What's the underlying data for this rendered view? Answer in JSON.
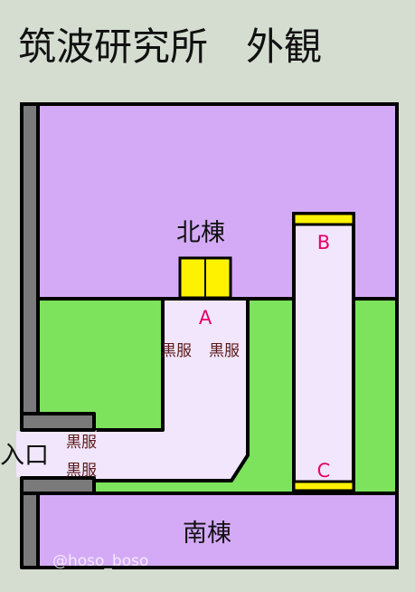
{
  "title": "筑波研究所　外観",
  "labels": {
    "north_building": "北棟",
    "south_building": "南棟",
    "entrance": "入口",
    "point_a": "A",
    "point_b": "B",
    "point_c": "C",
    "guard_1": "黒服",
    "guard_2": "黒服",
    "guard_3": "黒服",
    "guard_4": "黒服"
  },
  "watermark": "@hoso_boso",
  "colors": {
    "background": "#d5ddd1",
    "building": "#d4aaf7",
    "lawn": "#7de35c",
    "corridor": "#f1e6fb",
    "door": "#fff200",
    "wall": "#7a7a7a",
    "outline": "#000000",
    "marker": "#e4006a"
  }
}
